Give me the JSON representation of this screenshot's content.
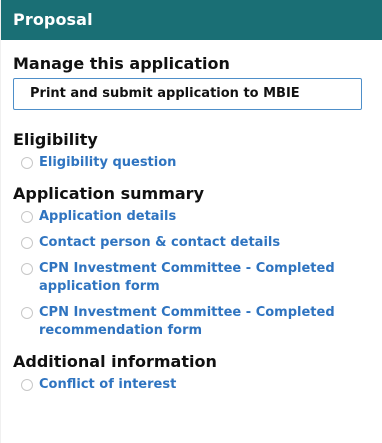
{
  "panel": {
    "title": "Proposal"
  },
  "sections": {
    "manage": {
      "title": "Manage this application",
      "items": [
        {
          "label": "Print and submit application to MBIE",
          "state": "half"
        }
      ]
    },
    "eligibility": {
      "title": "Eligibility",
      "items": [
        {
          "label": "Eligibility question",
          "state": "empty"
        }
      ]
    },
    "summary": {
      "title": "Application summary",
      "items": [
        {
          "label": "Application details",
          "state": "empty"
        },
        {
          "label": "Contact person & contact details",
          "state": "empty"
        },
        {
          "label_line1": "CPN Investment Committee - Completed",
          "label_line2": "application form",
          "state": "empty"
        },
        {
          "label_line1": "CPN Investment Committee - Completed",
          "label_line2": "recommendation form",
          "state": "empty"
        }
      ]
    },
    "additional": {
      "title": "Additional information",
      "items": [
        {
          "label": "Conflict of interest",
          "state": "empty"
        }
      ]
    }
  },
  "icons": {
    "item_status": "status-circle-icon"
  },
  "colors": {
    "header_bg": "#1a6f75",
    "link": "#2f74c0",
    "active_border": "#4e8fc9"
  }
}
